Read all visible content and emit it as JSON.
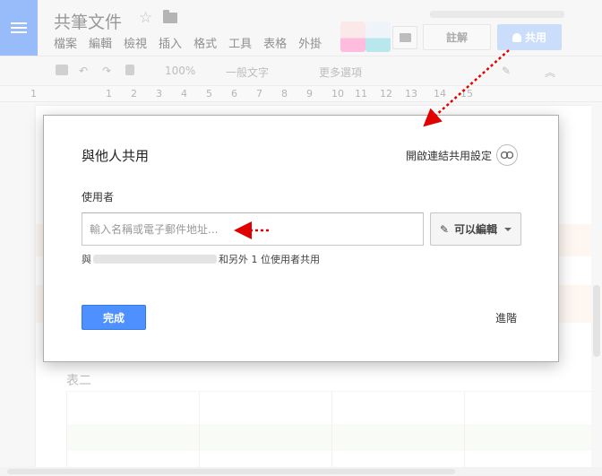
{
  "document": {
    "title": "共筆文件",
    "menu": [
      "檔案",
      "編輯",
      "檢視",
      "插入",
      "格式",
      "工具",
      "表格",
      "外掛"
    ],
    "comment_label": "註解",
    "share_label": "共用"
  },
  "toolbar": {
    "zoom": "100%",
    "style": "一般文字",
    "more": "更多選項"
  },
  "ruler": [
    "1",
    "1",
    "2",
    "3",
    "4",
    "5",
    "6",
    "7",
    "8",
    "9",
    "10",
    "11",
    "12",
    "13",
    "14",
    "15"
  ],
  "page": {
    "table_label": "表二"
  },
  "dialog": {
    "title": "與他人共用",
    "link_settings": "開啟連結共用設定",
    "people_label": "使用者",
    "input_placeholder": "輸入名稱或電子郵件地址...",
    "permission": "可以編輯",
    "shared_prefix": "與",
    "shared_suffix": "和另外 1 位使用者共用",
    "done": "完成",
    "advanced": "進階"
  },
  "colors": {
    "primary_blue": "#4d90fe",
    "annotation_red": "#e00000"
  }
}
